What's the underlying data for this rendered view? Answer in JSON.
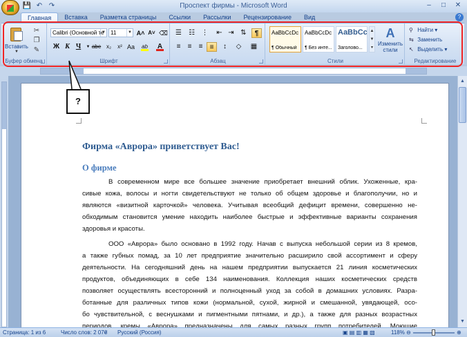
{
  "window": {
    "title": "Проспект фирмы - Microsoft Word",
    "controls": {
      "minimize": "–",
      "maximize": "□",
      "close": "✕"
    }
  },
  "qat": {
    "save": "💾",
    "undo": "↶",
    "redo": "↷"
  },
  "tabs": [
    {
      "label": "Главная",
      "active": true
    },
    {
      "label": "Вставка",
      "active": false
    },
    {
      "label": "Разметка страницы",
      "active": false
    },
    {
      "label": "Ссылки",
      "active": false
    },
    {
      "label": "Рассылки",
      "active": false
    },
    {
      "label": "Рецензирование",
      "active": false
    },
    {
      "label": "Вид",
      "active": false
    }
  ],
  "ribbon": {
    "clipboard": {
      "label": "Буфер обмена",
      "paste": "Вставить"
    },
    "font": {
      "label": "Шрифт",
      "font_name": "Calibri (Основной те",
      "font_size": "11",
      "grow": "A˄",
      "shrink": "A˅",
      "bold": "Ж",
      "italic": "К",
      "underline": "Ч",
      "strike": "abe",
      "subscript": "x₂",
      "superscript": "x²",
      "case": "Aa",
      "highlight": "ab",
      "font_color": "A",
      "highlight_color": "#ffff00",
      "text_color": "#e0231b"
    },
    "paragraph": {
      "label": "Абзац",
      "show_marks": "¶"
    },
    "styles": {
      "label": "Стили",
      "items": [
        {
          "sample": "AaBbCcDc",
          "name": "¶ Обычный",
          "selected": true
        },
        {
          "sample": "AaBbCcDc",
          "name": "¶ Без инте...",
          "selected": false
        },
        {
          "sample": "AaBbCc",
          "name": "Заголово...",
          "selected": false
        }
      ],
      "change_styles": "Изменить стили"
    },
    "editing": {
      "label": "Редактирование",
      "find": "Найти",
      "replace": "Заменить",
      "select": "Выделить"
    }
  },
  "callout": {
    "text": "?"
  },
  "document": {
    "title": "Фирма «Аврора» приветствует Вас!",
    "heading": "О фирме",
    "para1": [
      "В современном мире все большее значение приобретает внешний облик. Ухоженные, кра-",
      "сивые кожа, волосы и ногти свидетельствуют не только об общем здоровье и благополучии, но и",
      "являются «визитной карточкой» человека. Учитывая всеобщий дефицит времени, совершенно не-",
      "обходимым становится умение находить наиболее быстрые и эффективные варианты сохранения",
      "здоровья и красоты."
    ],
    "para2": [
      "ООО «Аврора» было основано в 1992 году. Начав с выпуска небольшой серии из 8 кремов,",
      "а также губных помад, за 10 лет предприятие значительно расширило свой ассортимент и сферу",
      "деятельности. На сегодняшний день на нашем предприятии выпускается 21 линия косметических",
      "продуктов, объединяющих в себе 134 наименования. Коллекция наших косметических средств",
      "позволяет осуществлять всесторонний и полноценный уход за собой в домашних условиях. Разра-",
      "ботанные для различных типов кожи (нормальной, сухой, жирной и смешанной, увядающей, осо-",
      "бо чувствительной, с веснушками и пигментными пятнами, и др.), а также для разных возрастных",
      "периодов, кремы «Аврора» предназначены для самых разных групп потребителей. Моющие"
    ]
  },
  "statusbar": {
    "page": "Страница: 1 из 6",
    "words": "Число слов: 2 076",
    "language": "Русский (Россия)",
    "zoom": "118%"
  }
}
